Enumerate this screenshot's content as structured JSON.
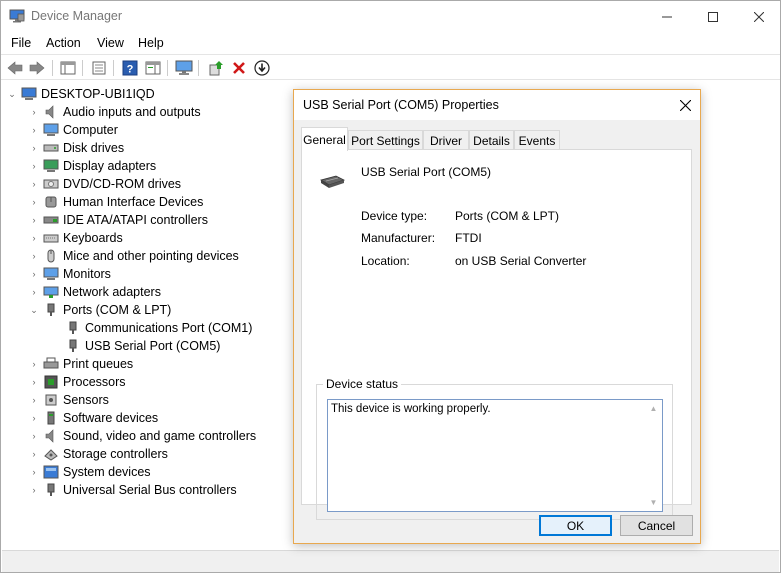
{
  "window": {
    "title": "Device Manager",
    "controls": {
      "minimize": "—",
      "maximize": "☐",
      "close": "✕"
    }
  },
  "menu": [
    "File",
    "Action",
    "View",
    "Help"
  ],
  "toolbar_icons": [
    "back-arrow-icon",
    "forward-arrow-icon",
    "show-hide-console-tree-icon",
    "properties-icon",
    "help-icon",
    "action-pane-icon",
    "monitor-icon",
    "update-driver-icon",
    "uninstall-x-icon",
    "download-arrow-icon"
  ],
  "tree": {
    "root": "DESKTOP-UBI1IQD",
    "categories": [
      "Audio inputs and outputs",
      "Computer",
      "Disk drives",
      "Display adapters",
      "DVD/CD-ROM drives",
      "Human Interface Devices",
      "IDE ATA/ATAPI controllers",
      "Keyboards",
      "Mice and other pointing devices",
      "Monitors",
      "Network adapters",
      "Ports (COM & LPT)",
      "Print queues",
      "Processors",
      "Sensors",
      "Software devices",
      "Sound, video and game controllers",
      "Storage controllers",
      "System devices",
      "Universal Serial Bus controllers"
    ],
    "ports_children": [
      "Communications Port (COM1)",
      "USB Serial Port (COM5)"
    ]
  },
  "dialog": {
    "title": "USB Serial Port (COM5) Properties",
    "close": "✕",
    "tabs": [
      "General",
      "Port Settings",
      "Driver",
      "Details",
      "Events"
    ],
    "active_tab": "General",
    "device_name": "USB Serial Port (COM5)",
    "props": [
      {
        "label": "Device type:",
        "value": "Ports (COM & LPT)"
      },
      {
        "label": "Manufacturer:",
        "value": "FTDI"
      },
      {
        "label": "Location:",
        "value": "on USB Serial Converter"
      }
    ],
    "status_legend": "Device status",
    "status_text": "This device is working properly.",
    "ok": "OK",
    "cancel": "Cancel"
  },
  "colors": {
    "accent": "#0078d7",
    "dialog_border": "#e8a84f"
  }
}
